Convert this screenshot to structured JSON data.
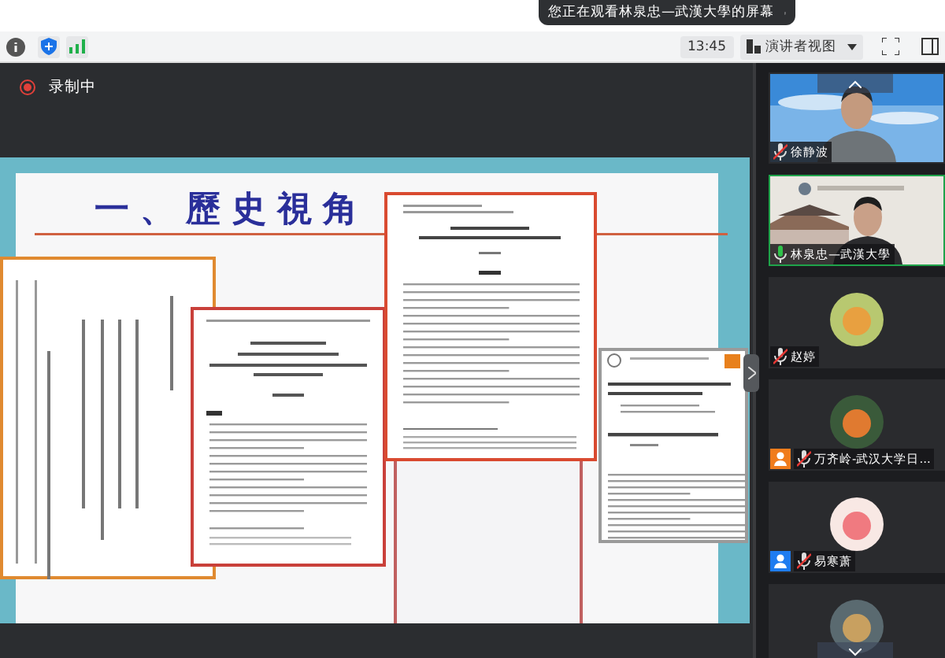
{
  "banner": {
    "text": "您正在观看林泉忠—武漢大學的屏幕"
  },
  "toolbar": {
    "clock": "13:45",
    "view_button": "演讲者视图"
  },
  "recording": {
    "label": "录制中"
  },
  "slide": {
    "title": "一、歷史視角"
  },
  "participants": [
    {
      "kind": "video",
      "name": "徐静波",
      "muted": true,
      "speaking": false
    },
    {
      "kind": "video",
      "name": "林泉忠—武漢大學",
      "muted": false,
      "speaking": true
    },
    {
      "kind": "avatar",
      "name": "赵婷",
      "muted": true,
      "speaking": false
    },
    {
      "kind": "avatar",
      "name": "万齐岭-武汉大学日...",
      "muted": true,
      "speaking": false,
      "color": "#f07c1c"
    },
    {
      "kind": "avatar",
      "name": "易寒萧",
      "muted": true,
      "speaking": false,
      "color": "#1e7cf0"
    },
    {
      "kind": "avatar",
      "speaking": false
    }
  ]
}
